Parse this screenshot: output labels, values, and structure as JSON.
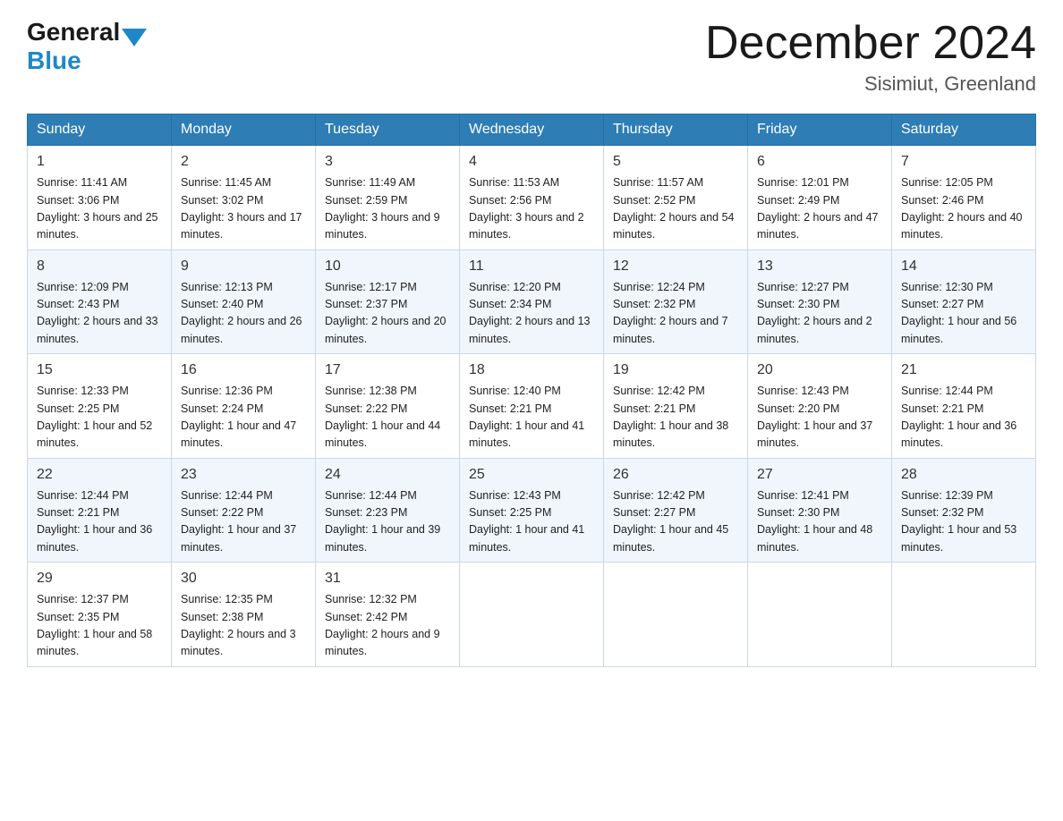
{
  "header": {
    "logo_general": "General",
    "logo_blue": "Blue",
    "month_title": "December 2024",
    "location": "Sisimiut, Greenland"
  },
  "weekdays": [
    "Sunday",
    "Monday",
    "Tuesday",
    "Wednesday",
    "Thursday",
    "Friday",
    "Saturday"
  ],
  "weeks": [
    [
      {
        "day": "1",
        "sunrise": "Sunrise: 11:41 AM",
        "sunset": "Sunset: 3:06 PM",
        "daylight": "Daylight: 3 hours and 25 minutes."
      },
      {
        "day": "2",
        "sunrise": "Sunrise: 11:45 AM",
        "sunset": "Sunset: 3:02 PM",
        "daylight": "Daylight: 3 hours and 17 minutes."
      },
      {
        "day": "3",
        "sunrise": "Sunrise: 11:49 AM",
        "sunset": "Sunset: 2:59 PM",
        "daylight": "Daylight: 3 hours and 9 minutes."
      },
      {
        "day": "4",
        "sunrise": "Sunrise: 11:53 AM",
        "sunset": "Sunset: 2:56 PM",
        "daylight": "Daylight: 3 hours and 2 minutes."
      },
      {
        "day": "5",
        "sunrise": "Sunrise: 11:57 AM",
        "sunset": "Sunset: 2:52 PM",
        "daylight": "Daylight: 2 hours and 54 minutes."
      },
      {
        "day": "6",
        "sunrise": "Sunrise: 12:01 PM",
        "sunset": "Sunset: 2:49 PM",
        "daylight": "Daylight: 2 hours and 47 minutes."
      },
      {
        "day": "7",
        "sunrise": "Sunrise: 12:05 PM",
        "sunset": "Sunset: 2:46 PM",
        "daylight": "Daylight: 2 hours and 40 minutes."
      }
    ],
    [
      {
        "day": "8",
        "sunrise": "Sunrise: 12:09 PM",
        "sunset": "Sunset: 2:43 PM",
        "daylight": "Daylight: 2 hours and 33 minutes."
      },
      {
        "day": "9",
        "sunrise": "Sunrise: 12:13 PM",
        "sunset": "Sunset: 2:40 PM",
        "daylight": "Daylight: 2 hours and 26 minutes."
      },
      {
        "day": "10",
        "sunrise": "Sunrise: 12:17 PM",
        "sunset": "Sunset: 2:37 PM",
        "daylight": "Daylight: 2 hours and 20 minutes."
      },
      {
        "day": "11",
        "sunrise": "Sunrise: 12:20 PM",
        "sunset": "Sunset: 2:34 PM",
        "daylight": "Daylight: 2 hours and 13 minutes."
      },
      {
        "day": "12",
        "sunrise": "Sunrise: 12:24 PM",
        "sunset": "Sunset: 2:32 PM",
        "daylight": "Daylight: 2 hours and 7 minutes."
      },
      {
        "day": "13",
        "sunrise": "Sunrise: 12:27 PM",
        "sunset": "Sunset: 2:30 PM",
        "daylight": "Daylight: 2 hours and 2 minutes."
      },
      {
        "day": "14",
        "sunrise": "Sunrise: 12:30 PM",
        "sunset": "Sunset: 2:27 PM",
        "daylight": "Daylight: 1 hour and 56 minutes."
      }
    ],
    [
      {
        "day": "15",
        "sunrise": "Sunrise: 12:33 PM",
        "sunset": "Sunset: 2:25 PM",
        "daylight": "Daylight: 1 hour and 52 minutes."
      },
      {
        "day": "16",
        "sunrise": "Sunrise: 12:36 PM",
        "sunset": "Sunset: 2:24 PM",
        "daylight": "Daylight: 1 hour and 47 minutes."
      },
      {
        "day": "17",
        "sunrise": "Sunrise: 12:38 PM",
        "sunset": "Sunset: 2:22 PM",
        "daylight": "Daylight: 1 hour and 44 minutes."
      },
      {
        "day": "18",
        "sunrise": "Sunrise: 12:40 PM",
        "sunset": "Sunset: 2:21 PM",
        "daylight": "Daylight: 1 hour and 41 minutes."
      },
      {
        "day": "19",
        "sunrise": "Sunrise: 12:42 PM",
        "sunset": "Sunset: 2:21 PM",
        "daylight": "Daylight: 1 hour and 38 minutes."
      },
      {
        "day": "20",
        "sunrise": "Sunrise: 12:43 PM",
        "sunset": "Sunset: 2:20 PM",
        "daylight": "Daylight: 1 hour and 37 minutes."
      },
      {
        "day": "21",
        "sunrise": "Sunrise: 12:44 PM",
        "sunset": "Sunset: 2:21 PM",
        "daylight": "Daylight: 1 hour and 36 minutes."
      }
    ],
    [
      {
        "day": "22",
        "sunrise": "Sunrise: 12:44 PM",
        "sunset": "Sunset: 2:21 PM",
        "daylight": "Daylight: 1 hour and 36 minutes."
      },
      {
        "day": "23",
        "sunrise": "Sunrise: 12:44 PM",
        "sunset": "Sunset: 2:22 PM",
        "daylight": "Daylight: 1 hour and 37 minutes."
      },
      {
        "day": "24",
        "sunrise": "Sunrise: 12:44 PM",
        "sunset": "Sunset: 2:23 PM",
        "daylight": "Daylight: 1 hour and 39 minutes."
      },
      {
        "day": "25",
        "sunrise": "Sunrise: 12:43 PM",
        "sunset": "Sunset: 2:25 PM",
        "daylight": "Daylight: 1 hour and 41 minutes."
      },
      {
        "day": "26",
        "sunrise": "Sunrise: 12:42 PM",
        "sunset": "Sunset: 2:27 PM",
        "daylight": "Daylight: 1 hour and 45 minutes."
      },
      {
        "day": "27",
        "sunrise": "Sunrise: 12:41 PM",
        "sunset": "Sunset: 2:30 PM",
        "daylight": "Daylight: 1 hour and 48 minutes."
      },
      {
        "day": "28",
        "sunrise": "Sunrise: 12:39 PM",
        "sunset": "Sunset: 2:32 PM",
        "daylight": "Daylight: 1 hour and 53 minutes."
      }
    ],
    [
      {
        "day": "29",
        "sunrise": "Sunrise: 12:37 PM",
        "sunset": "Sunset: 2:35 PM",
        "daylight": "Daylight: 1 hour and 58 minutes."
      },
      {
        "day": "30",
        "sunrise": "Sunrise: 12:35 PM",
        "sunset": "Sunset: 2:38 PM",
        "daylight": "Daylight: 2 hours and 3 minutes."
      },
      {
        "day": "31",
        "sunrise": "Sunrise: 12:32 PM",
        "sunset": "Sunset: 2:42 PM",
        "daylight": "Daylight: 2 hours and 9 minutes."
      },
      null,
      null,
      null,
      null
    ]
  ]
}
